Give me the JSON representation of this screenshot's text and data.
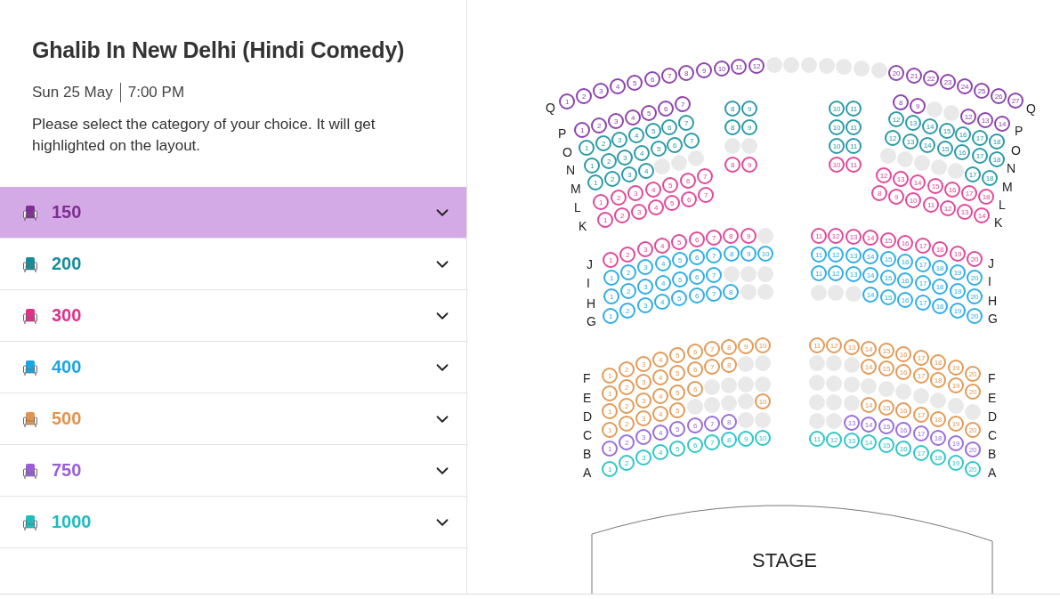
{
  "event": {
    "title": "Ghalib In New Delhi (Hindi Comedy)",
    "date": "Sun 25 May",
    "time": "7:00 PM",
    "instruction": "Please select the category of your choice. It will get highlighted on the layout."
  },
  "categories": [
    {
      "price": "150",
      "color": "#7e2f91",
      "selected": true
    },
    {
      "price": "200",
      "color": "#178d9c",
      "selected": false
    },
    {
      "price": "300",
      "color": "#e2308a",
      "selected": false
    },
    {
      "price": "400",
      "color": "#1ba6e2",
      "selected": false
    },
    {
      "price": "500",
      "color": "#e0944e",
      "selected": false
    },
    {
      "price": "750",
      "color": "#9a5fd6",
      "selected": false
    },
    {
      "price": "1000",
      "color": "#1fbcbf",
      "selected": false
    }
  ],
  "seat_map": {
    "row_labels": [
      "Q",
      "P",
      "O",
      "N",
      "M",
      "L",
      "K",
      "Q",
      "P",
      "O",
      "N",
      "M",
      "L",
      "K",
      "J",
      "I",
      "H",
      "G",
      "J",
      "I",
      "H",
      "G",
      "F",
      "E",
      "D",
      "C",
      "B",
      "A",
      "F",
      "E",
      "D",
      "C",
      "B",
      "A"
    ],
    "lines": [
      [
        {
          "booked": false,
          "color": "#8e44ad",
          "seats": [
            "1",
            "2",
            "3",
            "4",
            "5",
            "6",
            "7",
            "8",
            "9",
            "10",
            "11",
            "12"
          ]
        },
        {
          "seats": [
            {
              "booked": true
            },
            {
              "booked": true
            },
            {
              "booked": true
            },
            {
              "booked": true
            },
            {
              "booked": true
            },
            {
              "booked": true
            },
            {
              "booked": true
            }
          ]
        },
        {
          "booked": false,
          "color": "#8e44ad",
          "seats": [
            "20",
            "21",
            "22",
            "23",
            "24",
            "25",
            "26",
            "27"
          ]
        }
      ],
      [
        {
          "booked": false,
          "color": "#8e44ad",
          "seats": [
            "1",
            "2",
            "3",
            "4",
            "5",
            "6",
            "7"
          ]
        }
      ],
      [
        {
          "booked": false,
          "color": "#2a9aa8",
          "seats": [
            "1",
            "2",
            "3",
            "4",
            "5",
            "6",
            "7"
          ]
        }
      ],
      [
        {
          "booked": false,
          "color": "#2a9aa8",
          "seats": [
            "1",
            "2",
            "3",
            "4",
            "5",
            "6",
            "7"
          ]
        }
      ],
      [
        {
          "booked": false,
          "color": "#2a9aa8",
          "seats": [
            "1",
            "2",
            "3",
            "4"
          ]
        },
        {
          "seats": [
            {
              "booked": true
            },
            {
              "booked": true
            },
            {
              "booked": true
            }
          ]
        }
      ],
      [
        {
          "booked": false,
          "color": "#e2489a",
          "seats": [
            "1",
            "2",
            "3",
            "4",
            "5",
            "6",
            "7"
          ]
        }
      ],
      [
        {
          "booked": false,
          "color": "#e2489a",
          "seats": [
            "1",
            "2",
            "3",
            "4",
            "5",
            "6",
            "7"
          ]
        }
      ],
      [
        {
          "booked": false,
          "color": "#2a9aa8",
          "seats": [
            "8",
            "9"
          ]
        }
      ],
      [
        {
          "booked": false,
          "color": "#2a9aa8",
          "seats": [
            "8",
            "9"
          ]
        }
      ],
      [
        {
          "seats": [
            {
              "booked": true
            },
            {
              "booked": true
            }
          ]
        }
      ],
      [
        {
          "booked": false,
          "color": "#e2489a",
          "seats": [
            "8",
            "9"
          ]
        }
      ],
      [
        {
          "booked": false,
          "color": "#2a9aa8",
          "seats": [
            "10",
            "11"
          ]
        }
      ],
      [
        {
          "booked": false,
          "color": "#2a9aa8",
          "seats": [
            "10",
            "11"
          ]
        }
      ],
      [
        {
          "booked": false,
          "color": "#2a9aa8",
          "seats": [
            "10",
            "11"
          ]
        }
      ],
      [
        {
          "booked": false,
          "color": "#e2489a",
          "seats": [
            "10",
            "11"
          ]
        }
      ],
      [
        {
          "booked": false,
          "color": "#8e44ad",
          "seats": [
            "8",
            "9"
          ]
        },
        {
          "seats": [
            {
              "booked": true
            },
            {
              "booked": true
            }
          ]
        },
        {
          "booked": false,
          "color": "#8e44ad",
          "seats": [
            "12",
            "13",
            "14"
          ]
        }
      ],
      [
        {
          "booked": false,
          "color": "#2a9aa8",
          "seats": [
            "12",
            "13",
            "14",
            "15",
            "16",
            "17",
            "18"
          ]
        }
      ],
      [
        {
          "booked": false,
          "color": "#2a9aa8",
          "seats": [
            "12",
            "13",
            "14",
            "15",
            "16",
            "17",
            "18"
          ]
        }
      ],
      [
        {
          "seats": [
            {
              "booked": true
            },
            {
              "booked": true
            },
            {
              "booked": true
            },
            {
              "booked": true
            },
            {
              "booked": true
            }
          ]
        },
        {
          "booked": false,
          "color": "#2a9aa8",
          "seats": [
            "17",
            "18"
          ]
        }
      ],
      [
        {
          "booked": false,
          "color": "#e2489a",
          "seats": [
            "12",
            "13",
            "14",
            "15",
            "16",
            "17",
            "18"
          ]
        }
      ],
      [
        {
          "booked": false,
          "color": "#e2489a",
          "seats": [
            "8",
            "9",
            "10",
            "11",
            "12",
            "13",
            "14"
          ]
        }
      ],
      [
        {
          "booked": false,
          "color": "#e2489a",
          "seats": [
            "1",
            "2",
            "3",
            "4",
            "5",
            "6",
            "7",
            "8",
            "9"
          ]
        },
        {
          "seats": [
            {
              "booked": true
            }
          ]
        }
      ],
      [
        {
          "booked": false,
          "color": "#2eaee6",
          "seats": [
            "1",
            "2",
            "3",
            "4",
            "5",
            "6",
            "7",
            "8",
            "9",
            "10"
          ]
        }
      ],
      [
        {
          "booked": false,
          "color": "#2eaee6",
          "seats": [
            "1",
            "2",
            "3",
            "4",
            "5",
            "6",
            "7"
          ]
        },
        {
          "seats": [
            {
              "booked": true
            },
            {
              "booked": true
            },
            {
              "booked": true
            }
          ]
        }
      ],
      [
        {
          "booked": false,
          "color": "#2eaee6",
          "seats": [
            "1",
            "2",
            "3",
            "4",
            "5",
            "6",
            "7",
            "8"
          ]
        },
        {
          "seats": [
            {
              "booked": true
            },
            {
              "booked": true
            }
          ]
        }
      ],
      [
        {
          "booked": false,
          "color": "#e2489a",
          "seats": [
            "11",
            "12",
            "13",
            "14",
            "15",
            "16",
            "17",
            "18",
            "19",
            "20"
          ]
        }
      ],
      [
        {
          "booked": false,
          "color": "#2eaee6",
          "seats": [
            "11",
            "12",
            "13",
            "14",
            "15",
            "16",
            "17",
            "18",
            "19",
            "20"
          ]
        }
      ],
      [
        {
          "booked": false,
          "color": "#2eaee6",
          "seats": [
            "11",
            "12",
            "13",
            "14",
            "15",
            "16",
            "17",
            "18",
            "19",
            "20"
          ]
        }
      ],
      [
        {
          "seats": [
            {
              "booked": true
            },
            {
              "booked": true
            },
            {
              "booked": true
            }
          ]
        },
        {
          "booked": false,
          "color": "#2eaee6",
          "seats": [
            "14",
            "15",
            "16",
            "17",
            "18",
            "19",
            "20"
          ]
        }
      ],
      [
        {
          "booked": false,
          "color": "#e39a56",
          "seats": [
            "1",
            "2",
            "3",
            "4",
            "5",
            "6",
            "7",
            "8",
            "9",
            "10"
          ]
        }
      ],
      [
        {
          "booked": false,
          "color": "#e39a56",
          "seats": [
            "1",
            "2",
            "3",
            "4",
            "5",
            "6",
            "7",
            "8"
          ]
        },
        {
          "seats": [
            {
              "booked": true
            },
            {
              "booked": true
            }
          ]
        }
      ],
      [
        {
          "booked": false,
          "color": "#e39a56",
          "seats": [
            "1",
            "2",
            "3",
            "4",
            "5",
            "6"
          ]
        },
        {
          "seats": [
            {
              "booked": true
            },
            {
              "booked": true
            },
            {
              "booked": true
            },
            {
              "booked": true
            }
          ]
        }
      ],
      [
        {
          "booked": false,
          "color": "#e39a56",
          "seats": [
            "1",
            "2",
            "3",
            "4",
            "5"
          ]
        },
        {
          "seats": [
            {
              "booked": true
            },
            {
              "booked": true
            },
            {
              "booked": true
            },
            {
              "booked": true
            }
          ]
        },
        {
          "booked": false,
          "color": "#e39a56",
          "seats": [
            "10"
          ]
        }
      ],
      [
        {
          "booked": false,
          "color": "#9a6ddb",
          "seats": [
            "1",
            "2",
            "3",
            "4",
            "5",
            "6",
            "7",
            "8"
          ]
        },
        {
          "seats": [
            {
              "booked": true
            },
            {
              "booked": true
            }
          ]
        }
      ],
      [
        {
          "booked": false,
          "color": "#2ec6c8",
          "seats": [
            "1",
            "2",
            "3",
            "4",
            "5",
            "6",
            "7",
            "8",
            "9",
            "10"
          ]
        }
      ],
      [
        {
          "booked": false,
          "color": "#e39a56",
          "seats": [
            "11",
            "12",
            "13",
            "14",
            "15",
            "16",
            "17",
            "18",
            "19",
            "20"
          ]
        }
      ],
      [
        {
          "seats": [
            {
              "booked": true
            },
            {
              "booked": true
            },
            {
              "booked": true
            }
          ]
        },
        {
          "booked": false,
          "color": "#e39a56",
          "seats": [
            "14",
            "15",
            "16",
            "17",
            "18",
            "19",
            "20"
          ]
        }
      ],
      [
        {
          "seats": [
            {
              "booked": true
            },
            {
              "booked": true
            },
            {
              "booked": true
            },
            {
              "booked": true
            },
            {
              "booked": true
            },
            {
              "booked": true
            },
            {
              "booked": true
            },
            {
              "booked": true
            },
            {
              "booked": true
            },
            {
              "booked": true
            }
          ]
        }
      ],
      [
        {
          "seats": [
            {
              "booked": true
            },
            {
              "booked": true
            },
            {
              "booked": true
            }
          ]
        },
        {
          "booked": false,
          "color": "#e39a56",
          "seats": [
            "14",
            "15",
            "16",
            "17",
            "18",
            "19",
            "20"
          ]
        }
      ],
      [
        {
          "seats": [
            {
              "booked": true
            },
            {
              "booked": true
            }
          ]
        },
        {
          "booked": false,
          "color": "#9a6ddb",
          "seats": [
            "13",
            "14",
            "15",
            "16",
            "17",
            "18",
            "19",
            "20"
          ]
        }
      ],
      [
        {
          "booked": false,
          "color": "#2ec6c8",
          "seats": [
            "11",
            "12",
            "13",
            "14",
            "15",
            "16",
            "17",
            "18",
            "19",
            "20"
          ]
        }
      ]
    ],
    "stage": "STAGE"
  }
}
